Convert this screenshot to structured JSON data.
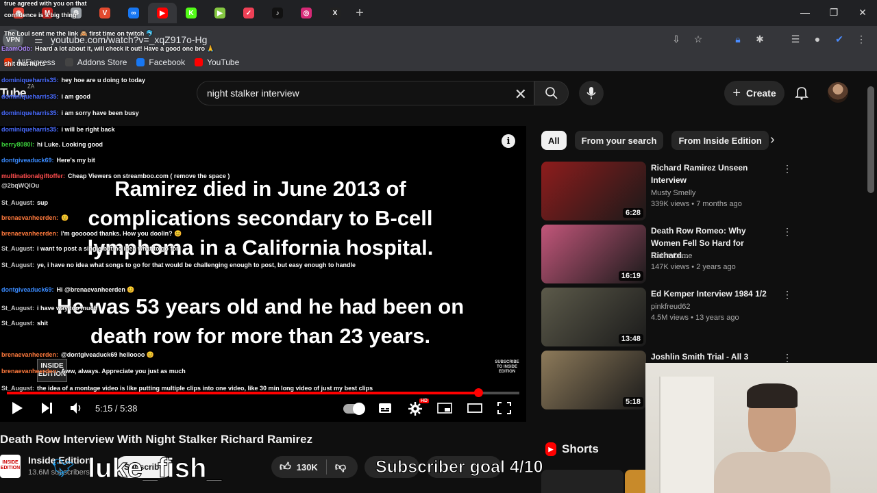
{
  "browser": {
    "tabs": [
      {
        "icon": "chrome-icon",
        "color": "#ea4335",
        "glyph": "◉"
      },
      {
        "icon": "gmail-icon",
        "color": "#c5221f",
        "glyph": "M"
      },
      {
        "icon": "settings-tab-icon",
        "color": "#9aa0a6",
        "glyph": "⚙"
      },
      {
        "icon": "vivaldi-tab-icon",
        "color": "#e34a2f",
        "glyph": "V"
      },
      {
        "icon": "meta-icon",
        "color": "#1877f2",
        "glyph": "∞"
      },
      {
        "icon": "youtube-icon",
        "color": "#ff0000",
        "glyph": "▶",
        "active": true
      },
      {
        "icon": "kick-icon",
        "color": "#53fc18",
        "glyph": "K"
      },
      {
        "icon": "rumble-icon",
        "color": "#85c742",
        "glyph": "▶"
      },
      {
        "icon": "pocket-icon",
        "color": "#ef4056",
        "glyph": "✓"
      },
      {
        "icon": "tiktok-icon",
        "color": "#111111",
        "glyph": "♪"
      },
      {
        "icon": "instagram-icon",
        "color": "#d62976",
        "glyph": "◎"
      },
      {
        "icon": "x-icon",
        "color": "#222222",
        "glyph": "X"
      }
    ],
    "new_tab": "+",
    "vpn_label": "VPN",
    "url": "youtube.com/watch?v=_xqZ917o-Hg",
    "bookmarks": [
      {
        "label": "AliExpress",
        "color": "#e62e04"
      },
      {
        "label": "Addons Store",
        "color": "#444444"
      },
      {
        "label": "Facebook",
        "color": "#1877f2"
      },
      {
        "label": "YouTube",
        "color": "#ff0000"
      }
    ]
  },
  "youtube": {
    "logo": "Tube",
    "region": "ZA",
    "search_value": "night stalker interview",
    "create_label": "Create"
  },
  "player": {
    "caption_1": "Ramirez died in June 2013 of complications secondary to B-cell lymphoma in a California hospital.",
    "caption_2": "He was 53 years old and he had been on death row for more than 23 years.",
    "watermark": "INSIDE EDITION",
    "subscribe_badge": "SUBSCRIBE TO INSIDE EDITION",
    "time": "5:15 / 5:38",
    "progress_fraction": 0.92,
    "hd_badge": "HD"
  },
  "chat": [
    {
      "user": "",
      "text": "true agreed with you on that",
      "color": "#ff6a6a"
    },
    {
      "user": "",
      "text": "confidence is a big thing",
      "color": "#ff6a6a"
    },
    {
      "user": "",
      "text": "The Loul sent me the link 🙈 first time on twitch 🐬",
      "color": "#ffffff"
    },
    {
      "user": "EaamOdb:",
      "text": "Heard a lot about it, will check it out! Have a good one bro 🙏",
      "color": "#b18bff"
    },
    {
      "user": "",
      "text": "shit that hurts",
      "color": "#ff6a6a"
    },
    {
      "user": "dominiqueharris35:",
      "text": "hey hoe are u doing to today",
      "color": "#4a6cff"
    },
    {
      "user": "dominiqueharris35:",
      "text": "i am good",
      "color": "#4a6cff"
    },
    {
      "user": "dominiqueharris35:",
      "text": "i am sorry have been busy",
      "color": "#4a6cff"
    },
    {
      "user": "dominiqueharris35:",
      "text": "i will be right back",
      "color": "#4a6cff"
    },
    {
      "user": "berry8080l:",
      "text": "hi Luke. Looking good",
      "color": "#3ccf3c"
    },
    {
      "user": "dontgiveaduck69:",
      "text": "Here's my bit",
      "color": "#3a8bff"
    },
    {
      "user": "multinationalgiftoffer:",
      "text": "Cheap Viewers on streamboo.com ( remove the space )",
      "color": "#ff4d4d"
    },
    {
      "user": "@2bqWQlOu",
      "text": "",
      "color": "#cccccc"
    },
    {
      "user": "St_August:",
      "text": "sup",
      "color": "#cccccc"
    },
    {
      "user": "brenaevanheerden:",
      "text": "😊",
      "color": "#ff7a3d"
    },
    {
      "user": "brenaevanheerden:",
      "text": "I'm goooood thanks. How you doolin? 😊",
      "color": "#ff7a3d"
    },
    {
      "user": "St_August:",
      "text": "i want to post a single but no idea what to go for",
      "color": "#cccccc"
    },
    {
      "user": "St_August:",
      "text": "ye, i have no idea what songs to go for that would be challenging enough to post, but easy enough to handle",
      "color": "#cccccc"
    },
    {
      "user": "dontgiveaduck69:",
      "text": "Hi @brenaevanheerden 😊",
      "color": "#3a8bff"
    },
    {
      "user": "St_August:",
      "text": "i have way too much",
      "color": "#cccccc"
    },
    {
      "user": "St_August:",
      "text": "shit",
      "color": "#cccccc"
    },
    {
      "user": "brenaevanheerden:",
      "text": "@dontgiveaduck69 helloooo 😊",
      "color": "#ff7a3d"
    },
    {
      "user": "brenaevanheerden:",
      "text": "Aww, always. Appreciate you just as much",
      "color": "#ff7a3d"
    },
    {
      "user": "St_August:",
      "text": "the idea of a montage video is like putting multiple clips into one video, like 30 min long video of just my best clips",
      "color": "#cccccc"
    }
  ],
  "video": {
    "title": "Death Row Interview With Night Stalker Richard Ramirez",
    "channel": "Inside Edition",
    "channel_avatar": "INSIDE EDITION",
    "subscribers": "13.6M subscribers",
    "subscribe_label": "Subscribe",
    "likes": "130K"
  },
  "overlay": {
    "twitter_handle": "luke_fish_",
    "subscriber_goal": "Subscriber goal 4/10"
  },
  "sidebar": {
    "chips": [
      "All",
      "From your search",
      "From Inside Edition"
    ],
    "recommendations": [
      {
        "title": "Richard Ramirez Unseen Interview",
        "channel": "Musty Smelly",
        "meta": "339K views • 7 months ago",
        "duration": "6:28",
        "thumb_color": "#8e1c1c"
      },
      {
        "title": "Death Row Romeo: Why Women Fell So Hard for Richard...",
        "channel": "Call It Crime",
        "meta": "147K views • 2 years ago",
        "duration": "16:19",
        "thumb_color": "#c2567a"
      },
      {
        "title": "Ed Kemper Interview 1984 1/2",
        "channel": "pinkfreud62",
        "meta": "4.5M views • 13 years ago",
        "duration": "13:48",
        "thumb_color": "#5c5a4a"
      },
      {
        "title": "Joshlin Smith Trial - All 3",
        "channel": "",
        "meta": "",
        "duration": "5:18",
        "thumb_color": "#8d7a5a"
      }
    ],
    "shorts_label": "Shorts"
  }
}
